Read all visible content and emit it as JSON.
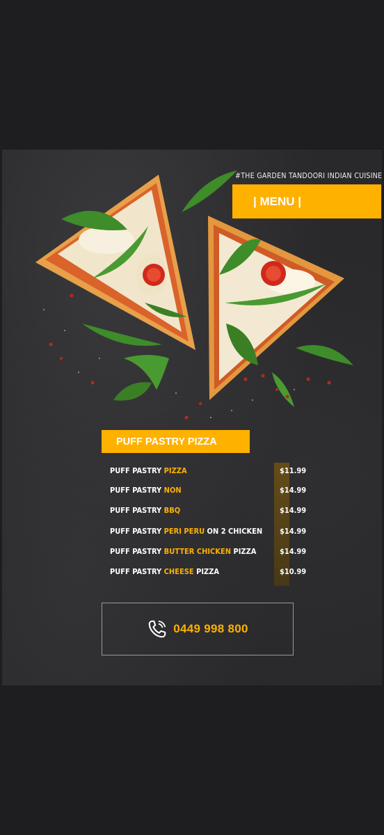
{
  "hashtag": "#THE GARDEN TANDOORI INDIAN CUISINE",
  "menu_button": "| MENU |",
  "section_title": "PUFF PASTRY PIZZA",
  "items": [
    {
      "prefix": "PUFF PASTRY ",
      "highlight": "PIZZA",
      "suffix": "",
      "price": "$11.99"
    },
    {
      "prefix": "PUFF PASTRY ",
      "highlight": "NON",
      "suffix": "",
      "price": "$14.99"
    },
    {
      "prefix": "PUFF PASTRY ",
      "highlight": "BBQ",
      "suffix": "",
      "price": "$14.99"
    },
    {
      "prefix": "PUFF PASTRY ",
      "highlight": "PERI PERU",
      "suffix": " ON 2 CHICKEN",
      "price": "$14.99"
    },
    {
      "prefix": "PUFF PASTRY ",
      "highlight": "BUTTER CHICKEN",
      "suffix": " PIZZA",
      "price": "$14.99"
    },
    {
      "prefix": "PUFF PASTRY ",
      "highlight": "CHEESE",
      "suffix": " PIZZA",
      "price": "$10.99"
    }
  ],
  "phone": "0449 998 800",
  "icons": {
    "phone": "phone-icon"
  },
  "colors": {
    "accent": "#ffb100",
    "background": "#29292b"
  }
}
